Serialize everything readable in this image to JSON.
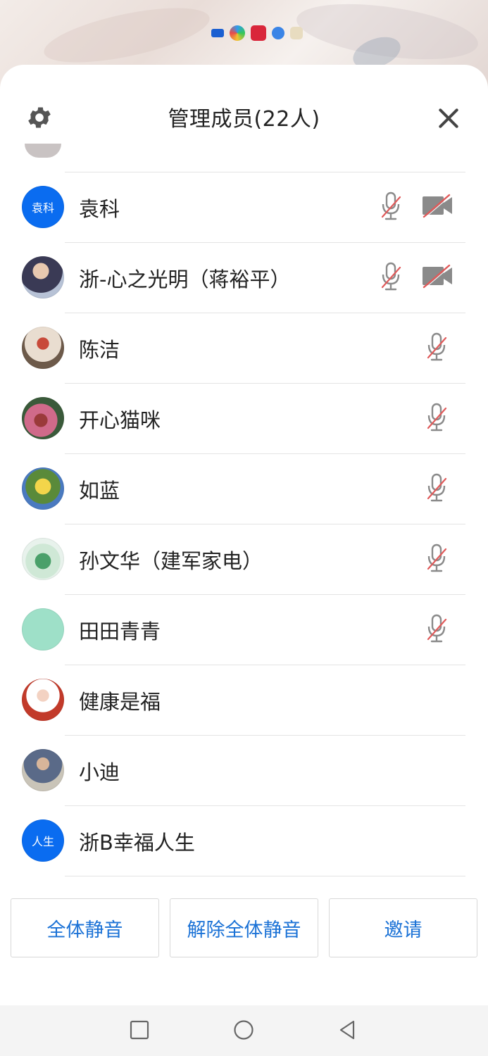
{
  "header": {
    "title": "管理成员(22人)"
  },
  "icons": {
    "settings": "gear-icon",
    "close": "close-icon",
    "mic_muted": "mic-muted-icon",
    "video_off": "video-off-icon"
  },
  "colors": {
    "accent": "#1b72d6",
    "avatar_blue": "#0a6cf0",
    "muted_slash": "#e05a5a",
    "icon_gray": "#8a8a8a"
  },
  "members": [
    {
      "name": "袁科",
      "avatar_text": "袁科",
      "mic_muted": true,
      "video_off": true
    },
    {
      "name": "浙-心之光明（蒋裕平）",
      "avatar_text": "",
      "mic_muted": true,
      "video_off": true
    },
    {
      "name": "陈洁",
      "avatar_text": "",
      "mic_muted": true,
      "video_off": false
    },
    {
      "name": "开心猫咪",
      "avatar_text": "",
      "mic_muted": true,
      "video_off": false
    },
    {
      "name": "如蓝",
      "avatar_text": "",
      "mic_muted": true,
      "video_off": false
    },
    {
      "name": "孙文华（建军家电）",
      "avatar_text": "",
      "mic_muted": true,
      "video_off": false
    },
    {
      "name": "田田青青",
      "avatar_text": "",
      "mic_muted": true,
      "video_off": false
    },
    {
      "name": "健康是福",
      "avatar_text": "",
      "mic_muted": false,
      "video_off": false
    },
    {
      "name": "小迪",
      "avatar_text": "",
      "mic_muted": false,
      "video_off": false
    },
    {
      "name": "浙B幸福人生",
      "avatar_text": "人生",
      "mic_muted": false,
      "video_off": false
    }
  ],
  "actions": {
    "mute_all": "全体静音",
    "unmute_all": "解除全体静音",
    "invite": "邀请"
  },
  "navbar": {
    "recent": "square-icon",
    "home": "circle-icon",
    "back": "triangle-back-icon"
  }
}
